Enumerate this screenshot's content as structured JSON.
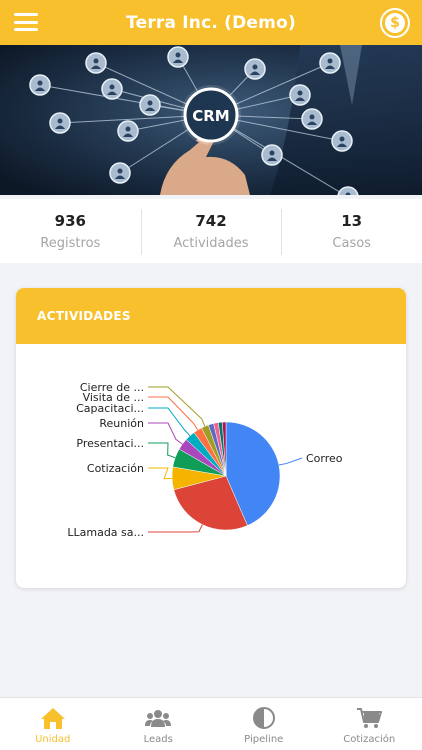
{
  "header": {
    "title": "Terra Inc. (Demo)",
    "hero_text": "CRM"
  },
  "stats": [
    {
      "value": "936",
      "label": "Registros"
    },
    {
      "value": "742",
      "label": "Actividades"
    },
    {
      "value": "13",
      "label": "Casos"
    }
  ],
  "card": {
    "title": "ACTIVIDADES"
  },
  "chart_data": {
    "type": "pie",
    "slices": [
      {
        "label": "Correo",
        "value": 43.5,
        "color": "#4285f4"
      },
      {
        "label": "LLamada sa...",
        "value": 27.4,
        "color": "#db4437"
      },
      {
        "label": "Cotización",
        "value": 6.8,
        "color": "#f4b400"
      },
      {
        "label": "Presentaci...",
        "value": 5.6,
        "color": "#0f9d58"
      },
      {
        "label": "Reunión",
        "value": 3.5,
        "color": "#ab47bc"
      },
      {
        "label": "Capacitaci...",
        "value": 3.1,
        "color": "#00acc1"
      },
      {
        "label": "Visita de ...",
        "value": 2.6,
        "color": "#ff7043"
      },
      {
        "label": "Cierre de ...",
        "value": 2.2,
        "color": "#9e9d24"
      },
      {
        "label": "",
        "value": 1.6,
        "color": "#5c6bc0"
      },
      {
        "label": "",
        "value": 1.4,
        "color": "#f06292"
      },
      {
        "label": "",
        "value": 1.2,
        "color": "#00796b"
      },
      {
        "label": "",
        "value": 1.1,
        "color": "#ad1457"
      }
    ]
  },
  "nav": [
    {
      "label": "Unidad",
      "icon": "home-icon",
      "active": true
    },
    {
      "label": "Leads",
      "icon": "people-icon",
      "active": false
    },
    {
      "label": "Pipeline",
      "icon": "half-circle-icon",
      "active": false
    },
    {
      "label": "Cotización",
      "icon": "cart-icon",
      "active": false
    }
  ],
  "colors": {
    "accent": "#f9c02d",
    "inactive": "#8a8a8a"
  }
}
